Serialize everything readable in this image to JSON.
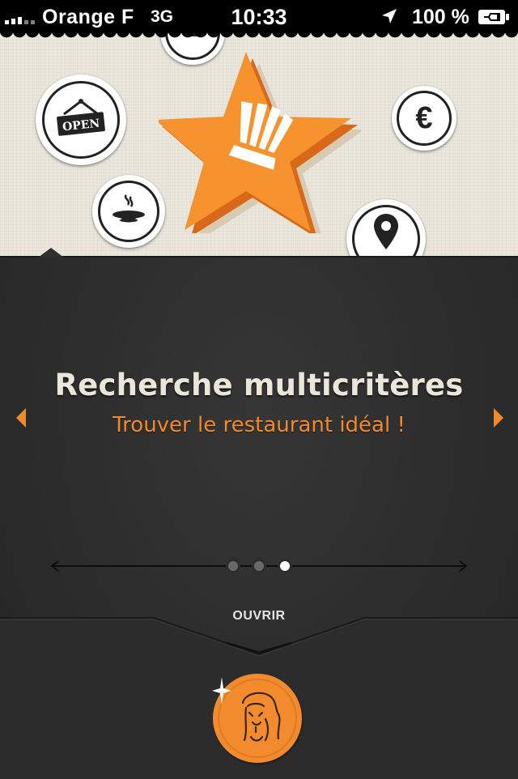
{
  "status_bar": {
    "carrier": "Orange F",
    "network": "3G",
    "time": "10:33",
    "battery": "100 %"
  },
  "hero": {
    "badges": [
      {
        "name": "open-sign-icon",
        "text": "OPEN"
      },
      {
        "name": "euro-icon",
        "text": "€"
      },
      {
        "name": "hot-dish-icon"
      },
      {
        "name": "location-pin-icon"
      },
      {
        "name": "cup-icon"
      }
    ],
    "star": {
      "name": "chef-hat-star-icon"
    }
  },
  "feature": {
    "title": "Recherche multicritères",
    "subtitle": "Trouver le restaurant idéal !"
  },
  "pager": {
    "count": 3,
    "active_index": 2
  },
  "open_button": {
    "label": "OUVRIR"
  },
  "logo": {
    "name": "lion-logo-icon"
  },
  "colors": {
    "accent": "#f08a2c",
    "panel": "#2e2e2e",
    "hero_bg": "#e8e3d9",
    "title": "#ebe6da"
  }
}
